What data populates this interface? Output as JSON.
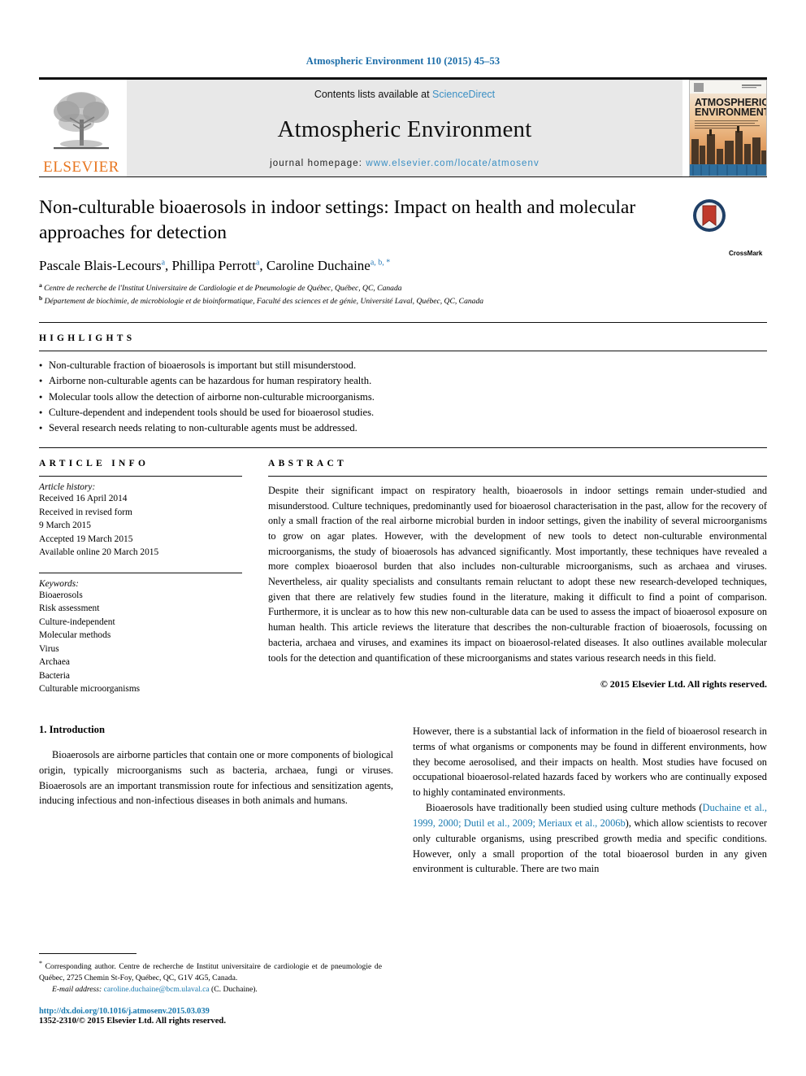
{
  "running_head": "Atmospheric Environment 110 (2015) 45–53",
  "masthead": {
    "publisher_name": "ELSEVIER",
    "contents_prefix": "Contents lists available at ",
    "sciencedirect": "ScienceDirect",
    "journal_title": "Atmospheric Environment",
    "homepage_prefix": "journal homepage: ",
    "homepage_url": "www.elsevier.com/locate/atmosenv",
    "cover_title_line1": "ATMOSPHERIC",
    "cover_title_line2": "ENVIRONMENT"
  },
  "article": {
    "title": "Non-culturable bioaerosols in indoor settings: Impact on health and molecular approaches for detection",
    "authors": [
      {
        "name": "Pascale Blais-Lecours",
        "marks": "a"
      },
      {
        "name": "Phillipa Perrott",
        "marks": "a"
      },
      {
        "name": "Caroline Duchaine",
        "marks": "a, b, *"
      }
    ],
    "affiliations": [
      {
        "mark": "a",
        "text": "Centre de recherche de l'Institut Universitaire de Cardiologie et de Pneumologie de Québec, Québec, QC, Canada"
      },
      {
        "mark": "b",
        "text": "Département de biochimie, de microbiologie et de bioinformatique, Faculté des sciences et de génie, Université Laval, Québec, QC, Canada"
      }
    ],
    "crossmark_label": "CrossMark"
  },
  "highlights": {
    "heading": "HIGHLIGHTS",
    "items": [
      "Non-culturable fraction of bioaerosols is important but still misunderstood.",
      "Airborne non-culturable agents can be hazardous for human respiratory health.",
      "Molecular tools allow the detection of airborne non-culturable microorganisms.",
      "Culture-dependent and independent tools should be used for bioaerosol studies.",
      "Several research needs relating to non-culturable agents must be addressed."
    ]
  },
  "article_info": {
    "heading": "ARTICLE INFO",
    "history_title": "Article history:",
    "history": [
      "Received 16 April 2014",
      "Received in revised form",
      "9 March 2015",
      "Accepted 19 March 2015",
      "Available online 20 March 2015"
    ],
    "keywords_title": "Keywords:",
    "keywords": [
      "Bioaerosols",
      "Risk assessment",
      "Culture-independent",
      "Molecular methods",
      "Virus",
      "Archaea",
      "Bacteria",
      "Culturable microorganisms"
    ]
  },
  "abstract": {
    "heading": "ABSTRACT",
    "text": "Despite their significant impact on respiratory health, bioaerosols in indoor settings remain under-studied and misunderstood. Culture techniques, predominantly used for bioaerosol characterisation in the past, allow for the recovery of only a small fraction of the real airborne microbial burden in indoor settings, given the inability of several microorganisms to grow on agar plates. However, with the development of new tools to detect non-culturable environmental microorganisms, the study of bioaerosols has advanced significantly. Most importantly, these techniques have revealed a more complex bioaerosol burden that also includes non-culturable microorganisms, such as archaea and viruses. Nevertheless, air quality specialists and consultants remain reluctant to adopt these new research-developed techniques, given that there are relatively few studies found in the literature, making it difficult to find a point of comparison. Furthermore, it is unclear as to how this new non-culturable data can be used to assess the impact of bioaerosol exposure on human health. This article reviews the literature that describes the non-culturable fraction of bioaerosols, focussing on bacteria, archaea and viruses, and examines its impact on bioaerosol-related diseases. It also outlines available molecular tools for the detection and quantification of these microorganisms and states various research needs in this field.",
    "copyright": "© 2015 Elsevier Ltd. All rights reserved."
  },
  "body": {
    "section_heading": "1. Introduction",
    "left_paragraph": "Bioaerosols are airborne particles that contain one or more components of biological origin, typically microorganisms such as bacteria, archaea, fungi or viruses. Bioaerosols are an important transmission route for infectious and sensitization agents, inducing infectious and non-infectious diseases in both animals and humans.",
    "right_paragraph_1": "However, there is a substantial lack of information in the field of bioaerosol research in terms of what organisms or components may be found in different environments, how they become aerosolised, and their impacts on health. Most studies have focused on occupational bioaerosol-related hazards faced by workers who are continually exposed to highly contaminated environments.",
    "right_paragraph_2_pre": "Bioaerosols have traditionally been studied using culture methods (",
    "right_paragraph_2_cite": "Duchaine et al., 1999, 2000; Dutil et al., 2009; Meriaux et al., 2006b",
    "right_paragraph_2_post": "), which allow scientists to recover only culturable organisms, using prescribed growth media and specific conditions. However, only a small proportion of the total bioaerosol burden in any given environment is culturable. There are two main"
  },
  "footnotes": {
    "corresponding_marker": "*",
    "corresponding_text": "Corresponding author. Centre de recherche de Institut universitaire de cardiologie et de pneumologie de Québec, 2725 Chemin St-Foy, Québec, QC, G1V 4G5, Canada.",
    "email_label": "E-mail address:",
    "email_value": "caroline.duchaine@bcm.ulaval.ca",
    "email_suffix": "(C. Duchaine).",
    "doi": "http://dx.doi.org/10.1016/j.atmosenv.2015.03.039",
    "issn_line": "1352-2310/© 2015 Elsevier Ltd. All rights reserved."
  },
  "colors": {
    "link_blue": "#1a7ab0",
    "header_blue": "#1a6ca8",
    "elsevier_orange": "#E87722",
    "band_gray": "#e8e8e8"
  }
}
